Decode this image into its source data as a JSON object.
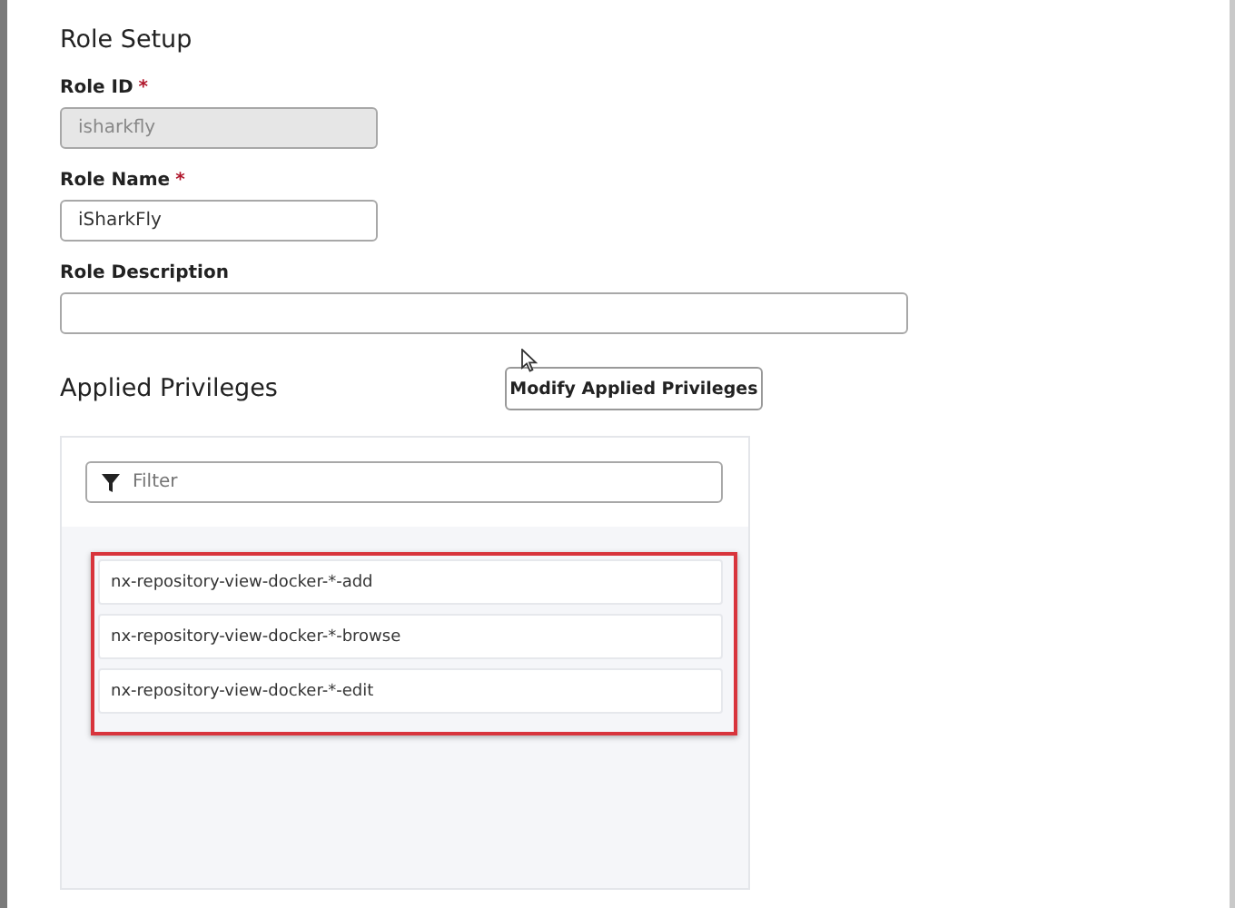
{
  "title": "Role Setup",
  "fields": [
    {
      "label": "Role ID",
      "required_mark": "*",
      "value": "isharkfly",
      "disabled": true,
      "kind": "short"
    },
    {
      "label": "Role Name",
      "required_mark": "*",
      "value": "iSharkFly",
      "disabled": false,
      "kind": "short"
    },
    {
      "label": "Role Description",
      "disabled": false,
      "kind": "wide"
    }
  ],
  "privileges": {
    "heading": "Applied Privileges",
    "button": "Modify Applied Privileges",
    "filter": {
      "placeholder": "Filter"
    },
    "highlighted": true,
    "items": [
      {
        "name": "nx-repository-view-docker-*-add"
      },
      {
        "name": "nx-repository-view-docker-*-browse"
      },
      {
        "name": "nx-repository-view-docker-*-edit"
      }
    ]
  }
}
